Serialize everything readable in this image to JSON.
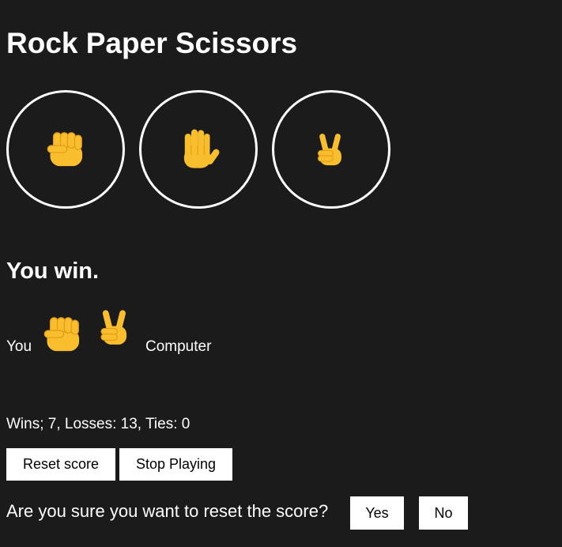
{
  "title": "Rock Paper Scissors",
  "choices": [
    {
      "name": "rock",
      "icon": "raised-fist-icon"
    },
    {
      "name": "paper",
      "icon": "raised-hand-icon"
    },
    {
      "name": "scissors",
      "icon": "victory-hand-icon"
    }
  ],
  "result": {
    "text": "You win.",
    "player_label": "You",
    "player_icon": "raised-fist-icon",
    "computer_label": "Computer",
    "computer_icon": "victory-hand-icon"
  },
  "score_text": "Wins; 7, Losses: 13, Ties: 0",
  "buttons": {
    "reset_label": "Reset score",
    "stop_label": "Stop Playing"
  },
  "confirm": {
    "question": "Are you sure you want to reset the score?",
    "yes_label": "Yes",
    "no_label": "No"
  },
  "colors": {
    "background": "#1b1b1b",
    "text": "#ffffff",
    "emoji": "#f9be2e",
    "emoji_shade": "#e19b16"
  }
}
